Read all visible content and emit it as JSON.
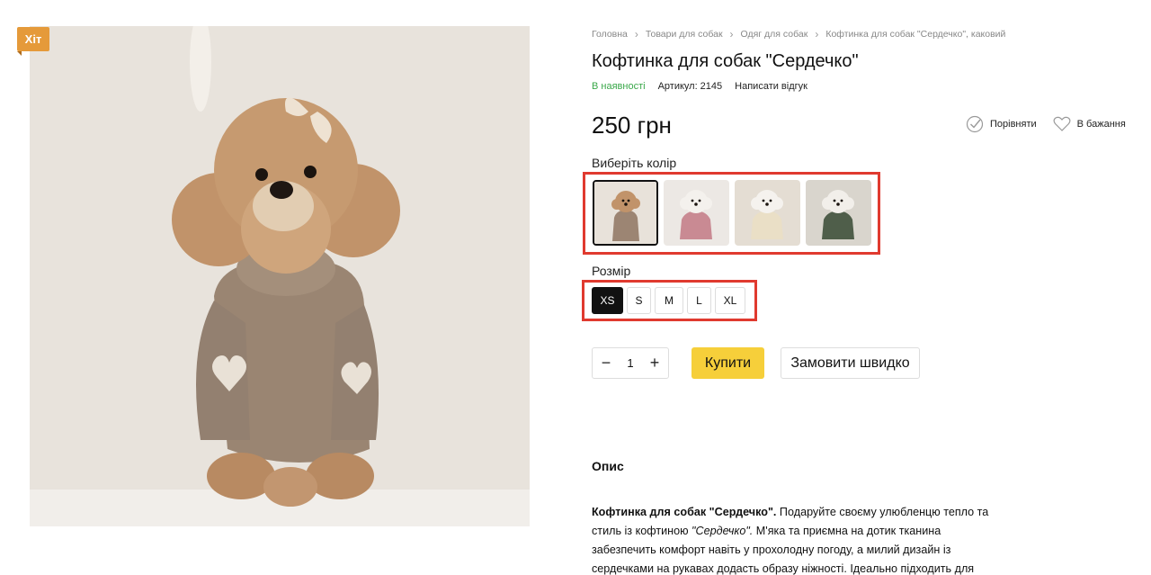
{
  "badge": "Хіт",
  "breadcrumb": [
    "Головна",
    "Товари для собак",
    "Одяг для собак",
    "Кофтинка для собак \"Сердечко\", каковий"
  ],
  "product": {
    "title": "Кофтинка для собак \"Сердечко\"",
    "stock": "В наявності",
    "article": "Артикул: 2145",
    "review_link": "Написати відгук",
    "price": "250 грн"
  },
  "actions": {
    "compare": "Порівняти",
    "wishlist": "В бажання"
  },
  "color": {
    "label": "Виберіть колір",
    "swatches": [
      {
        "name": "swatch-brown",
        "color": "#b48a6c",
        "selected": true
      },
      {
        "name": "swatch-pink",
        "color": "#c98a93",
        "selected": false
      },
      {
        "name": "swatch-cream",
        "color": "#e8dcc0",
        "selected": false
      },
      {
        "name": "swatch-green",
        "color": "#4f5e4a",
        "selected": false
      }
    ]
  },
  "size": {
    "label": "Розмір",
    "options": [
      "XS",
      "S",
      "M",
      "L",
      "XL"
    ],
    "selected": "XS"
  },
  "purchase": {
    "quantity": "1",
    "buy_label": "Купити",
    "quick_label": "Замовити швидко"
  },
  "description": {
    "heading": "Опис",
    "bold_intro": "Кофтинка для собак \"Сердечко\".",
    "text1": " Подаруйте своєму улюбленцю тепло та стиль із кофтиною ",
    "italic": "\"Сердечко\".",
    "text2": " М'яка та приємна на дотик тканина забезпечить комфорт навіть у прохолодну погоду, а милий дизайн із сердечками на рукавах додасть образу ніжності. Ідеально підходить для маленьких порід собак."
  }
}
